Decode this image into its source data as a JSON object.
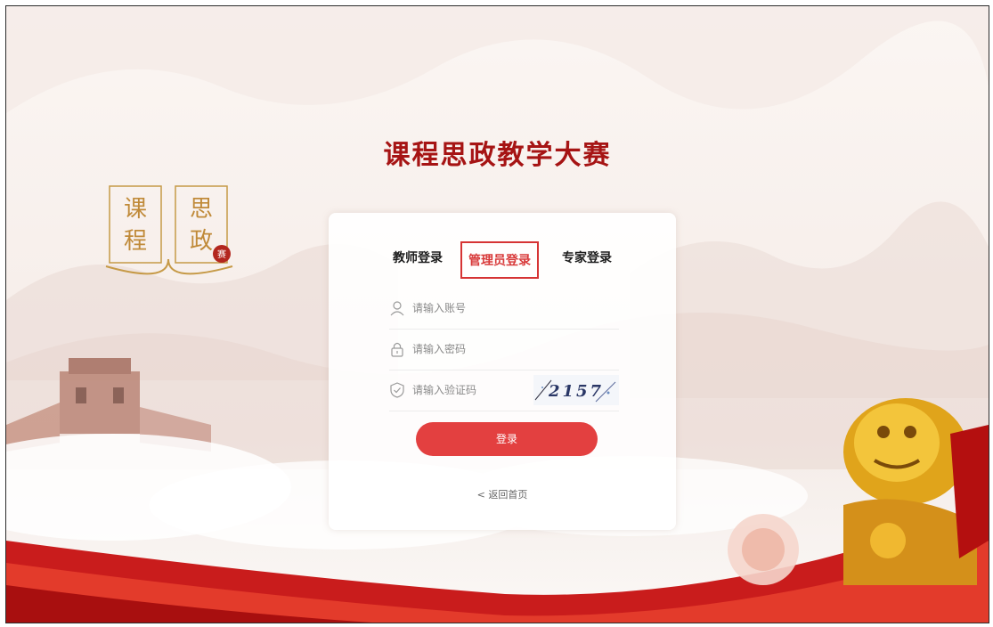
{
  "page": {
    "title": "课程思政教学大赛",
    "seal_chars": [
      "课",
      "程",
      "思",
      "政"
    ],
    "seal_stamp": "赛"
  },
  "tabs": [
    {
      "label": "教师登录",
      "active": false
    },
    {
      "label": "管理员登录",
      "active": true
    },
    {
      "label": "专家登录",
      "active": false
    }
  ],
  "form": {
    "account_placeholder": "请输入账号",
    "password_placeholder": "请输入密码",
    "captcha_placeholder": "请输入验证码",
    "captcha_text": "2157",
    "login_label": "登录",
    "back_label": "< 返回首页"
  },
  "colors": {
    "accent": "#e34040",
    "title": "#a61414",
    "frame_border": "#2b2b2b"
  },
  "icons": [
    "user-icon",
    "lock-icon",
    "shield-icon"
  ]
}
